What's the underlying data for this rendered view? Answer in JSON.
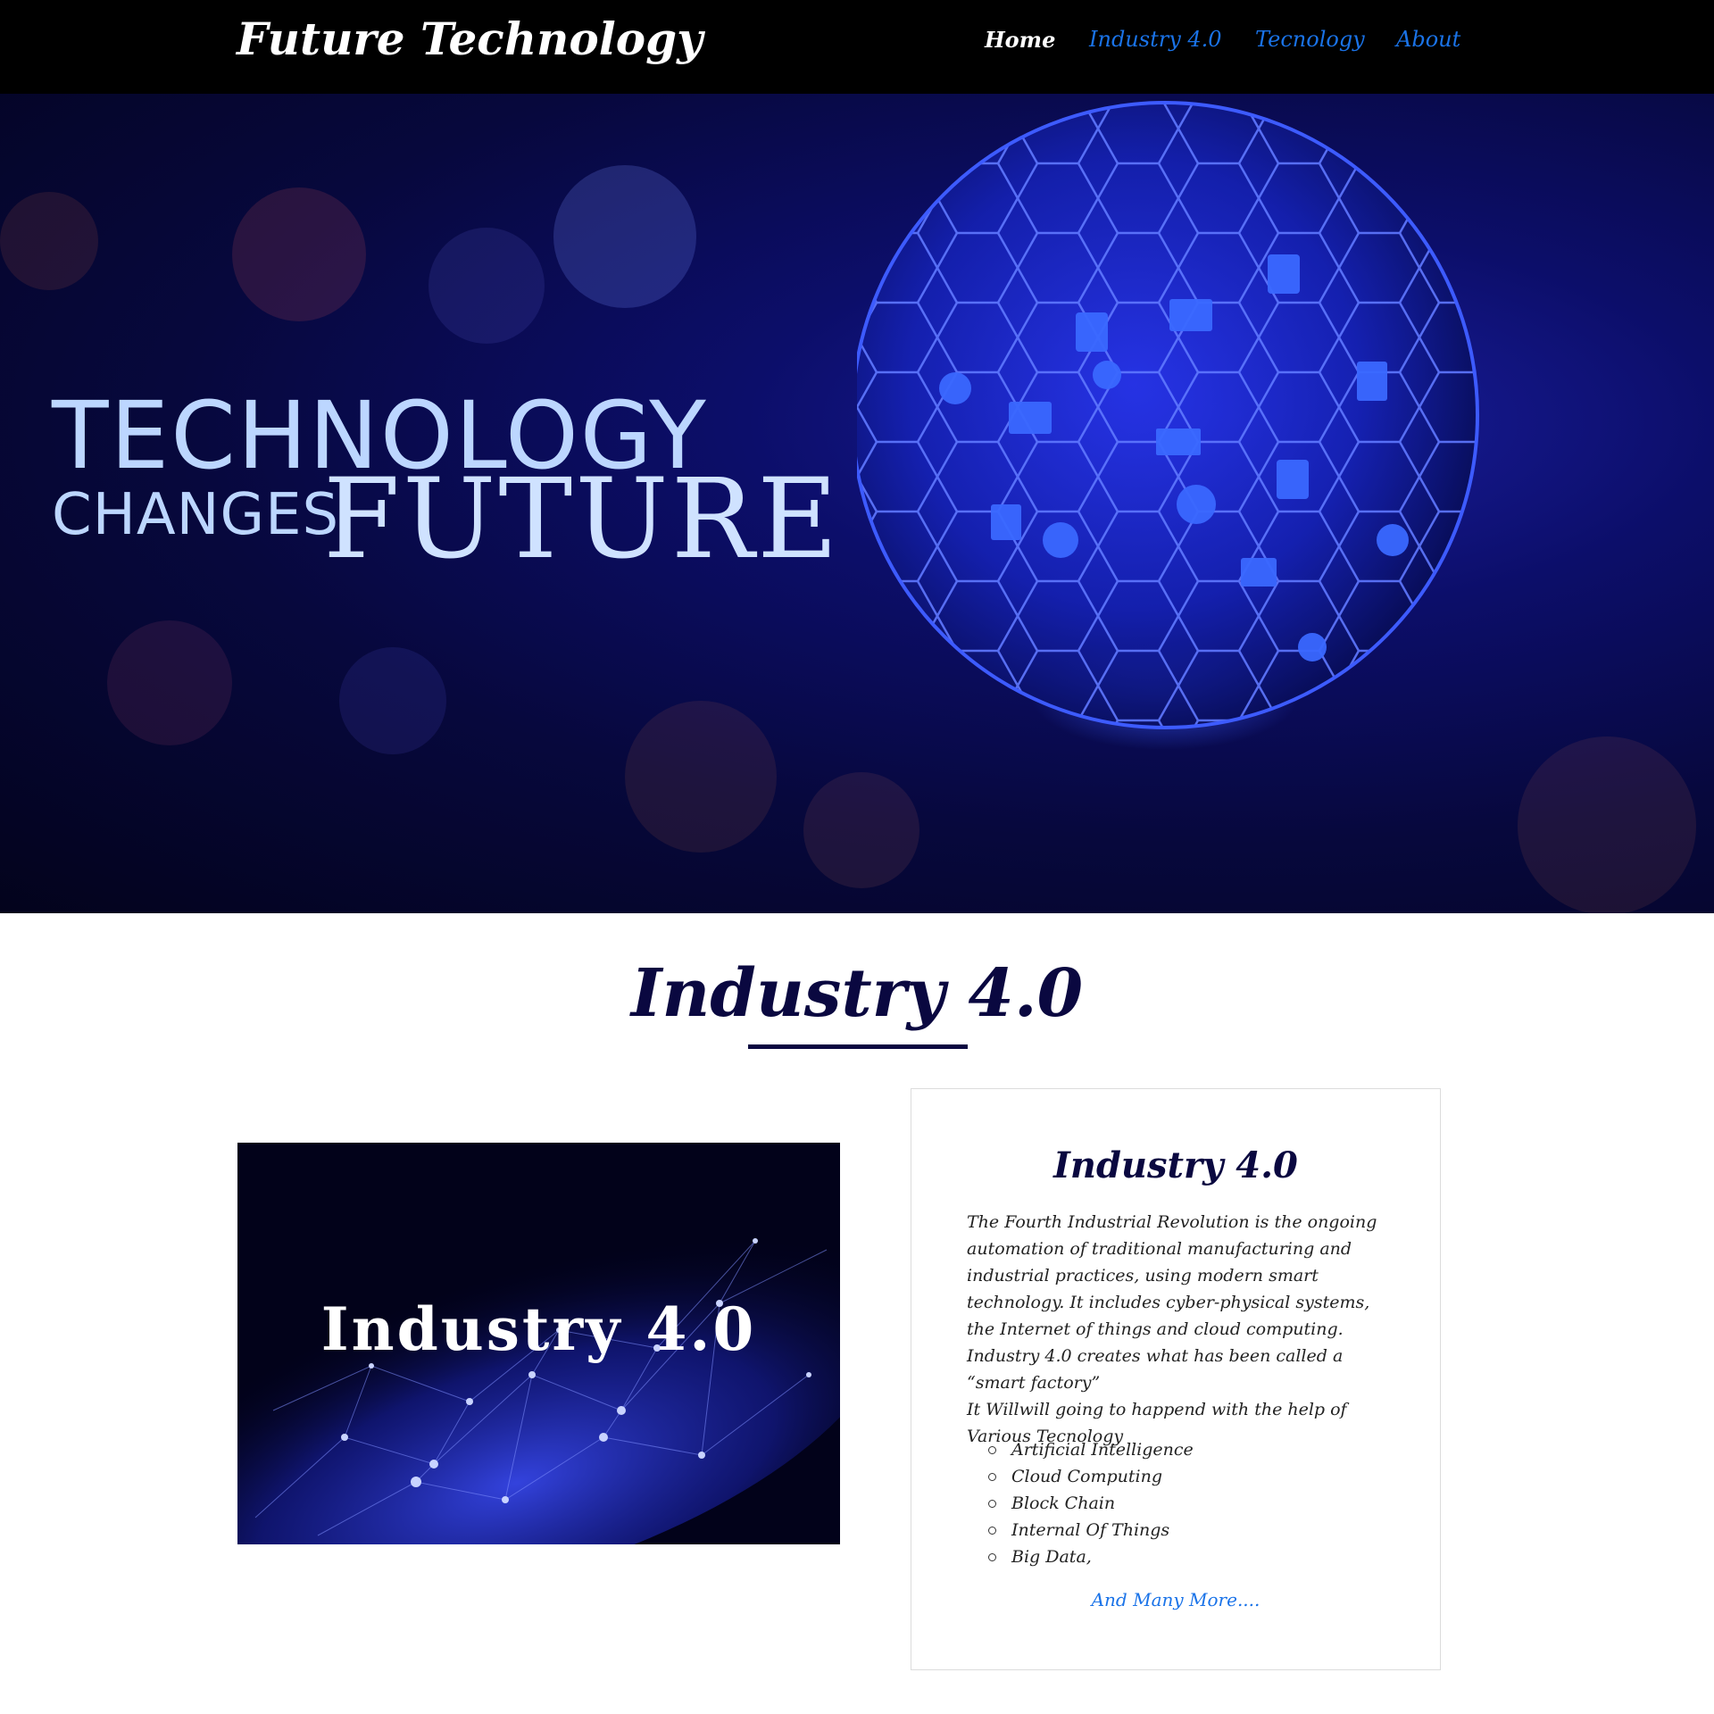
{
  "colors": {
    "nav_bg": "#000000",
    "nav_link": "#1a73e8",
    "heading": "#0a0840",
    "link": "#1a73e8"
  },
  "navbar": {
    "brand": "Future Technology",
    "links": [
      {
        "label": "Home",
        "active": true
      },
      {
        "label": "Industry 4.0",
        "active": false
      },
      {
        "label": "Tecnology",
        "active": false
      },
      {
        "label": "About",
        "active": false
      }
    ]
  },
  "hero": {
    "line1": "TECHNOLOGY",
    "line2": "CHANGES",
    "line3": "FUTURE",
    "icon": "globe-network-icon"
  },
  "section": {
    "title": "Industry 4.0",
    "image_label": "Industry 4.0",
    "card": {
      "title": "Industry 4.0",
      "paragraph1": "The Fourth Industrial Revolution is the ongoing automation of traditional manufacturing and industrial practices, using modern smart technology. It includes cyber-physical systems, the Internet of things and cloud computing. Industry 4.0 creates what has been called a “smart factory”",
      "paragraph2": "It Willwill going to happend with the help of Various Tecnology",
      "list": [
        "Artificial Intelligence",
        "Cloud Computing",
        "Block Chain",
        "Internal Of Things",
        "Big Data,"
      ],
      "more_link": "And Many More...."
    }
  }
}
